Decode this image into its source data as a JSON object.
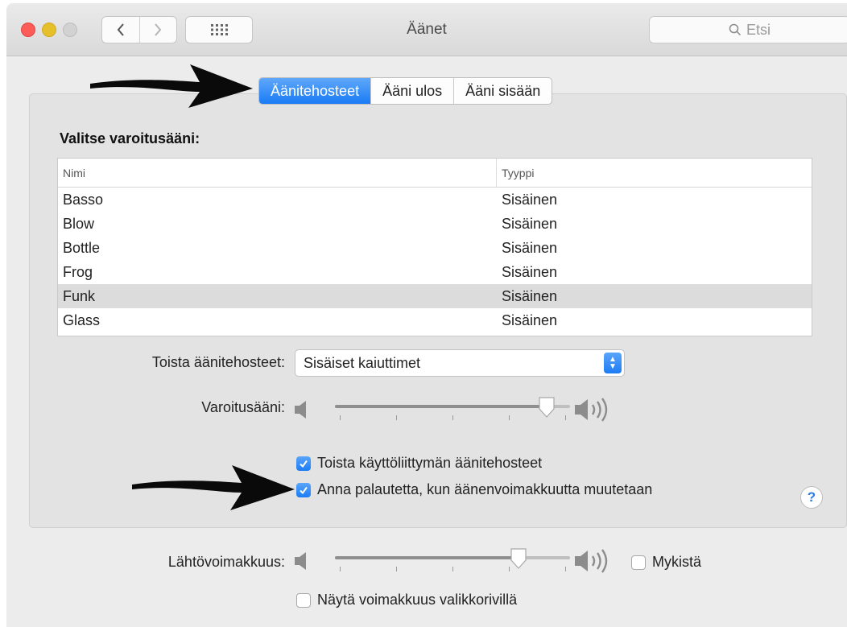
{
  "window": {
    "title": "Äänet"
  },
  "search": {
    "placeholder": "Etsi",
    "icon": "search-icon"
  },
  "tabs": [
    {
      "label": "Äänitehosteet",
      "active": true
    },
    {
      "label": "Ääni ulos",
      "active": false
    },
    {
      "label": "Ääni sisään",
      "active": false
    }
  ],
  "alert_section": {
    "label": "Valitse varoitusääni:",
    "columns": {
      "name": "Nimi",
      "type": "Tyyppi"
    },
    "rows": [
      {
        "name": "Basso",
        "type": "Sisäinen",
        "selected": false
      },
      {
        "name": "Blow",
        "type": "Sisäinen",
        "selected": false
      },
      {
        "name": "Bottle",
        "type": "Sisäinen",
        "selected": false
      },
      {
        "name": "Frog",
        "type": "Sisäinen",
        "selected": false
      },
      {
        "name": "Funk",
        "type": "Sisäinen",
        "selected": true
      },
      {
        "name": "Glass",
        "type": "Sisäinen",
        "selected": false
      }
    ]
  },
  "play_effects": {
    "label": "Toista äänitehosteet:",
    "value": "Sisäiset kaiuttimet"
  },
  "alert_volume": {
    "label": "Varoitusääni:",
    "level": 0.9
  },
  "checkboxes": {
    "ui_effects": {
      "label": "Toista käyttöliittymän äänitehosteet",
      "checked": true
    },
    "feedback": {
      "label": "Anna palautetta, kun äänenvoimakkuutta muutetaan",
      "checked": true
    }
  },
  "help": {
    "label": "?"
  },
  "output_volume": {
    "label": "Lähtövoimakkuus:",
    "level": 0.78,
    "mute_label": "Mykistä",
    "mute_checked": false
  },
  "show_in_menubar": {
    "label": "Näytä voimakkuus valikkorivillä",
    "checked": false
  },
  "colors": {
    "accent": "#1a7cf5",
    "arrow": "#0a0a0a"
  }
}
